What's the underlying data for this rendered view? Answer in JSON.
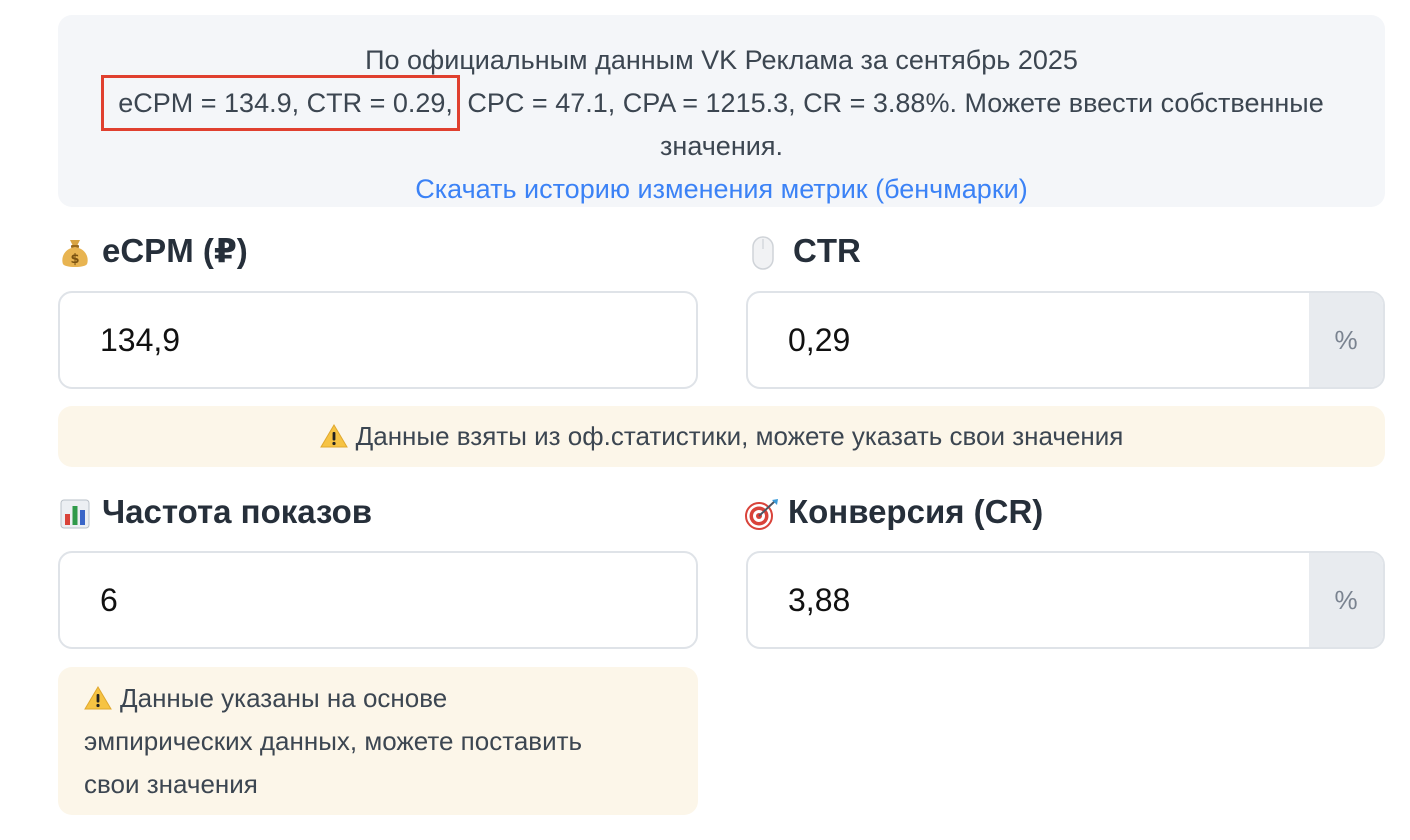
{
  "info": {
    "line1": "По официальным данным VK Реклама за сентябрь 2025",
    "highlighted": "eCPM = 134.9, CTR = 0.29,",
    "rest": " CPC = 47.1, CPA = 1215.3, CR = 3.88%. Можете ввести собственные",
    "line3": "значения.",
    "link": "Скачать историю изменения метрик (бенчмарки)",
    "highlight_color": "#e0402f"
  },
  "fields": {
    "ecpm": {
      "label": "eCPM (₽)",
      "icon": "money-bag-icon",
      "value": "134,9"
    },
    "ctr": {
      "label": "CTR",
      "icon": "mouse-icon",
      "value": "0,29",
      "suffix": "%"
    },
    "frequency": {
      "label": "Частота показов",
      "icon": "bar-chart-icon",
      "value": "6"
    },
    "cr": {
      "label": "Конверсия (CR)",
      "icon": "target-icon",
      "value": "3,88",
      "suffix": "%"
    }
  },
  "notices": {
    "official": "Данные взяты из оф.статистики, можете указать свои значения",
    "empirical_line1": "Данные указаны на основе",
    "empirical_line2": "эмпирических данных, можете поставить",
    "empirical_line3": "свои значения"
  },
  "colors": {
    "link": "#3b82f6",
    "notice_bg": "#fcf6e9",
    "info_bg": "#f4f6f9"
  }
}
